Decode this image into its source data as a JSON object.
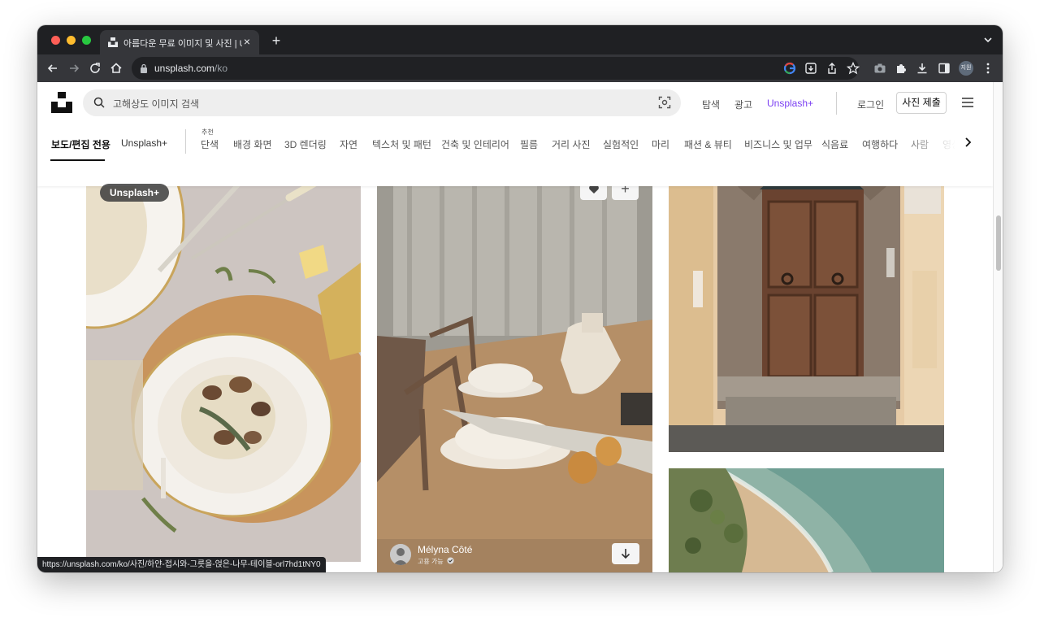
{
  "browser": {
    "tab_title": "아름다운 무료 이미지 및 사진 | Unsp",
    "url_domain": "unsplash.com",
    "url_path": "/ko",
    "profile_initials": "지원",
    "status_url": "https://unsplash.com/ko/사진/하얀-접시와-그릇을-얹은-나무-테이블-orl7hd1tNY0"
  },
  "header": {
    "search_placeholder": "고해상도 이미지 검색",
    "nav": {
      "explore": "탐색",
      "advertise": "광고",
      "unsplash_plus": "Unsplash+",
      "login": "로그인",
      "submit_photo": "사진 제출"
    }
  },
  "topics": {
    "active": "보도/편집 전용",
    "unsplash_plus": "Unsplash+",
    "recommended_label": "추천",
    "items": [
      "단색",
      "배경 화면",
      "3D 렌더링",
      "자연",
      "텍스처 및 패턴",
      "건축 및 인테리어",
      "필름",
      "거리 사진",
      "실험적인",
      "마리",
      "패션 & 뷰티",
      "비즈니스 및 업무",
      "식음료",
      "여행하다",
      "사람",
      "영상"
    ]
  },
  "gallery": {
    "badge": "Unsplash+",
    "featured_author": {
      "name": "Mélyna Côté",
      "hire_label": "고용 가능"
    }
  },
  "icons": {
    "like": "heart-icon",
    "add": "plus-icon",
    "download": "download-icon",
    "verified": "check-badge-icon"
  },
  "colors": {
    "unsplash_plus": "#7b3ff2",
    "browser_chrome": "#35363a"
  }
}
